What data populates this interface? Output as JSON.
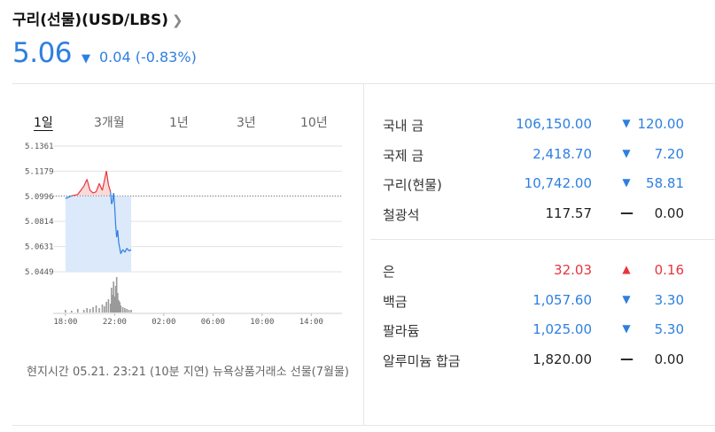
{
  "header": {
    "title": "구리(선물)(USD/LBS)",
    "price": "5.06",
    "change": "0.04",
    "change_pct": "(-0.83%)",
    "direction": "down"
  },
  "periods": [
    {
      "label": "1일",
      "active": true
    },
    {
      "label": "3개월",
      "active": false
    },
    {
      "label": "1년",
      "active": false
    },
    {
      "label": "3년",
      "active": false
    },
    {
      "label": "10년",
      "active": false
    }
  ],
  "chart_data": {
    "type": "line",
    "y_ticks": [
      "5.1361",
      "5.1179",
      "5.0996",
      "5.0814",
      "5.0631",
      "5.0449"
    ],
    "x_ticks": [
      "18:00",
      "22:00",
      "02:00",
      "06:00",
      "10:00",
      "14:00"
    ],
    "reference_value": 5.1,
    "ylim": [
      5.0449,
      5.1361
    ],
    "series": [
      {
        "times": [
          "18:00",
          "18:30",
          "19:00",
          "19:30",
          "19:45",
          "20:00",
          "20:15",
          "20:30",
          "20:45",
          "21:00",
          "21:10",
          "21:20",
          "21:30",
          "21:40",
          "21:45",
          "21:50",
          "21:55",
          "22:00",
          "22:05",
          "22:10",
          "22:15",
          "22:20",
          "22:25",
          "22:30",
          "22:40",
          "22:50",
          "23:00",
          "23:10",
          "23:21"
        ],
        "values": [
          5.098,
          5.1,
          5.101,
          5.107,
          5.112,
          5.104,
          5.102,
          5.103,
          5.109,
          5.104,
          5.111,
          5.118,
          5.108,
          5.103,
          5.094,
          5.096,
          5.102,
          5.093,
          5.079,
          5.07,
          5.075,
          5.066,
          5.062,
          5.058,
          5.061,
          5.059,
          5.062,
          5.06,
          5.061
        ]
      }
    ],
    "volume": [
      3,
      2,
      4,
      3,
      5,
      4,
      6,
      8,
      5,
      9,
      7,
      12,
      15,
      10,
      28,
      20,
      35,
      18,
      30,
      40,
      22,
      14,
      12,
      8,
      6,
      5,
      4,
      3,
      3
    ]
  },
  "footnote": "현지시간 05.21. 23:21 (10분 지연) 뉴욕상품거래소 선물(7월물)",
  "rows": [
    {
      "name": "국내 금",
      "value": "106,150.00",
      "dir": "down",
      "change": "120.00"
    },
    {
      "name": "국제 금",
      "value": "2,418.70",
      "dir": "down",
      "change": "7.20"
    },
    {
      "name": "구리(현물)",
      "value": "10,742.00",
      "dir": "down",
      "change": "58.81"
    },
    {
      "name": "철광석",
      "value": "117.57",
      "dir": "flat",
      "change": "0.00"
    }
  ],
  "rows2": [
    {
      "name": "은",
      "value": "32.03",
      "dir": "up",
      "change": "0.16"
    },
    {
      "name": "백금",
      "value": "1,057.60",
      "dir": "down",
      "change": "3.30"
    },
    {
      "name": "팔라듐",
      "value": "1,025.00",
      "dir": "down",
      "change": "5.30"
    },
    {
      "name": "알루미늄 합금",
      "value": "1,820.00",
      "dir": "flat",
      "change": "0.00"
    }
  ],
  "colors": {
    "down": "#2d7fe0",
    "up": "#e8333d",
    "flat": "#222222"
  },
  "icons": {
    "down": "triangle-down-icon",
    "up": "triangle-up-icon",
    "flat": "dash-icon",
    "more": "chevron-right-icon"
  }
}
